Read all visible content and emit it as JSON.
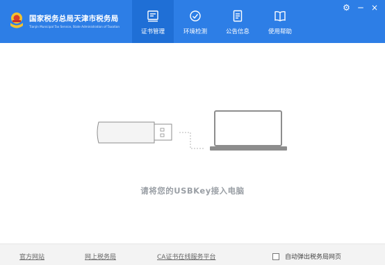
{
  "header": {
    "title": "国家税务总局天津市税务局",
    "subtitle": "Tianjin Municipal Tax Service, State Administration of Taxation",
    "nav": [
      {
        "label": "证书管理",
        "icon": "certificate-icon",
        "active": true
      },
      {
        "label": "环境检测",
        "icon": "gauge-icon",
        "active": false
      },
      {
        "label": "公告信息",
        "icon": "document-icon",
        "active": false
      },
      {
        "label": "使用帮助",
        "icon": "book-icon",
        "active": false
      }
    ],
    "window_controls": {
      "settings": "⚙",
      "minimize": "−",
      "close": "×"
    }
  },
  "main": {
    "prompt": "请将您的USBKey接入电脑"
  },
  "footer": {
    "links": [
      "官方网站",
      "网上税务局",
      "CA证书在线服务平台"
    ],
    "checkbox_label": "自动弹出税务局网页",
    "checkbox_checked": false
  },
  "colors": {
    "header": "#2d7ee6",
    "active_tab": "#1f6fd6",
    "footer": "#f3f3f3"
  }
}
